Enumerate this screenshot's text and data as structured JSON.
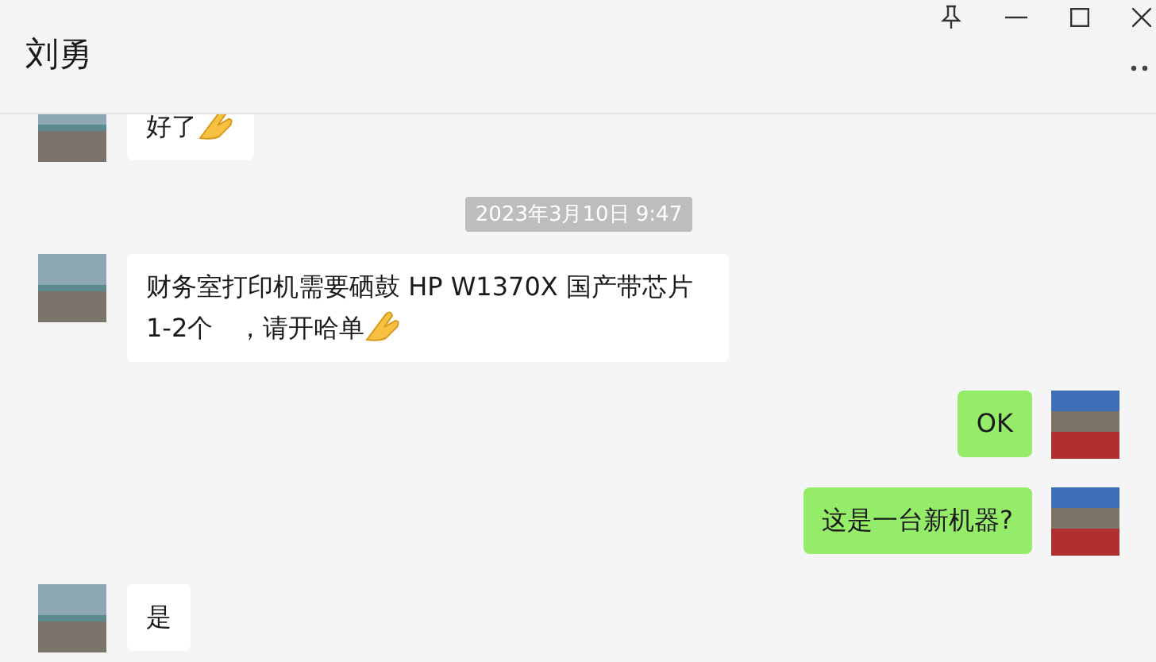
{
  "window": {
    "title": "刘勇"
  },
  "messages": [
    {
      "kind": "text",
      "outgoing": false,
      "text": "好了",
      "emoji": true
    },
    {
      "kind": "time",
      "text": "2023年3月10日 9:47"
    },
    {
      "kind": "text",
      "outgoing": false,
      "text": "财务室打印机需要硒鼓 HP W1370X 国产带芯片     1-2个   ，请开哈单",
      "emoji": true
    },
    {
      "kind": "text",
      "outgoing": true,
      "text": "OK",
      "emoji": false
    },
    {
      "kind": "text",
      "outgoing": true,
      "text": "这是一台新机器?",
      "emoji": false
    },
    {
      "kind": "text",
      "outgoing": false,
      "text": "是",
      "emoji": false
    }
  ]
}
